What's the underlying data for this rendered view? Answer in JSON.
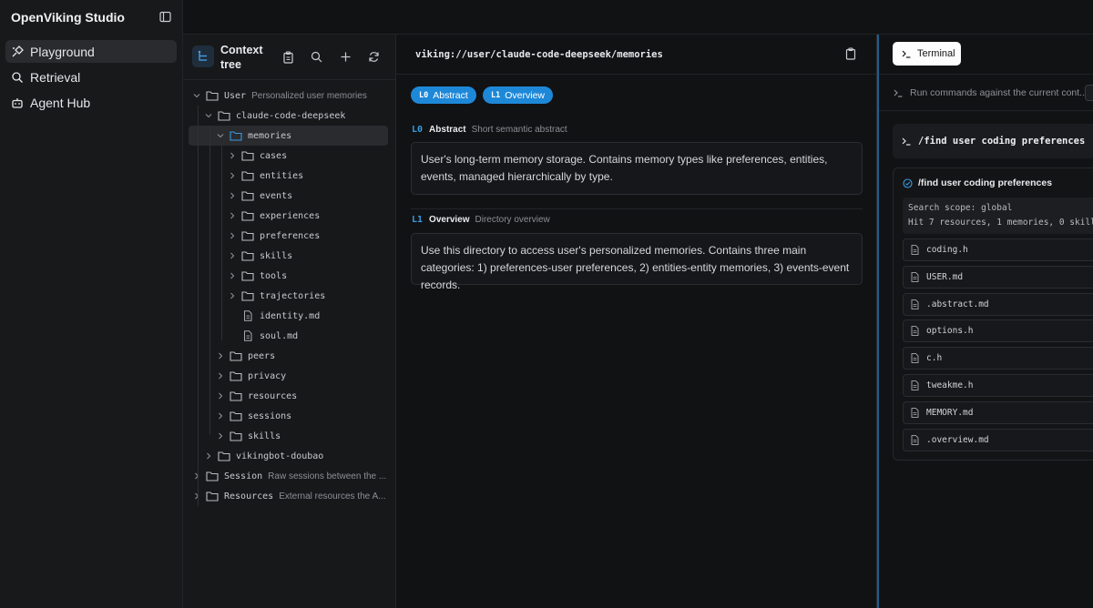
{
  "app": {
    "title": "OpenViking Studio"
  },
  "nav": {
    "items": [
      {
        "label": "Playground",
        "icon": "pen-nib-icon",
        "active": true
      },
      {
        "label": "Retrieval",
        "icon": "search-icon",
        "active": false
      },
      {
        "label": "Agent Hub",
        "icon": "robot-icon",
        "active": false
      }
    ]
  },
  "tree": {
    "title": "Context tree",
    "rows": [
      {
        "name": "User",
        "desc": "Personalized user memories",
        "type": "folder",
        "depth": 0,
        "expanded": true
      },
      {
        "name": "claude-code-deepseek",
        "desc": "",
        "type": "folder",
        "depth": 1,
        "expanded": true
      },
      {
        "name": "memories",
        "desc": "",
        "type": "folder",
        "depth": 2,
        "expanded": true,
        "selected": true
      },
      {
        "name": "cases",
        "desc": "",
        "type": "folder",
        "depth": 3,
        "expanded": false
      },
      {
        "name": "entities",
        "desc": "",
        "type": "folder",
        "depth": 3,
        "expanded": false
      },
      {
        "name": "events",
        "desc": "",
        "type": "folder",
        "depth": 3,
        "expanded": false
      },
      {
        "name": "experiences",
        "desc": "",
        "type": "folder",
        "depth": 3,
        "expanded": false
      },
      {
        "name": "preferences",
        "desc": "",
        "type": "folder",
        "depth": 3,
        "expanded": false
      },
      {
        "name": "skills",
        "desc": "",
        "type": "folder",
        "depth": 3,
        "expanded": false
      },
      {
        "name": "tools",
        "desc": "",
        "type": "folder",
        "depth": 3,
        "expanded": false
      },
      {
        "name": "trajectories",
        "desc": "",
        "type": "folder",
        "depth": 3,
        "expanded": false
      },
      {
        "name": "identity.md",
        "desc": "",
        "type": "file",
        "depth": 3
      },
      {
        "name": "soul.md",
        "desc": "",
        "type": "file",
        "depth": 3
      },
      {
        "name": "peers",
        "desc": "",
        "type": "folder",
        "depth": 2,
        "expanded": false
      },
      {
        "name": "privacy",
        "desc": "",
        "type": "folder",
        "depth": 2,
        "expanded": false
      },
      {
        "name": "resources",
        "desc": "",
        "type": "folder",
        "depth": 2,
        "expanded": false
      },
      {
        "name": "sessions",
        "desc": "",
        "type": "folder",
        "depth": 2,
        "expanded": false
      },
      {
        "name": "skills",
        "desc": "",
        "type": "folder",
        "depth": 2,
        "expanded": false
      },
      {
        "name": "vikingbot-doubao",
        "desc": "",
        "type": "folder",
        "depth": 1,
        "expanded": false
      },
      {
        "name": "Session",
        "desc": "Raw sessions between the ...",
        "type": "folder",
        "depth": 0,
        "expanded": false
      },
      {
        "name": "Resources",
        "desc": "External resources the A...",
        "type": "folder",
        "depth": 0,
        "expanded": false
      }
    ]
  },
  "detail": {
    "path": "viking://user/claude-code-deepseek/memories",
    "pills": [
      {
        "level": "L0",
        "label": "Abstract"
      },
      {
        "level": "L1",
        "label": "Overview"
      }
    ],
    "abstract": {
      "level": "L0",
      "title": "Abstract",
      "subtitle": "Short semantic abstract",
      "text": "User's long-term memory storage. Contains memory types like preferences, entities, events, managed hierarchically by type."
    },
    "overview": {
      "level": "L1",
      "title": "Overview",
      "subtitle": "Directory overview",
      "text": "Use this directory to access user's personalized memories. Contains three main categories: 1) preferences-user preferences, 2) entities-entity memories, 3) events-event records."
    }
  },
  "terminal": {
    "tab_label": "Terminal",
    "hint": "Run commands against the current cont...",
    "command": "/find user coding preferences",
    "result": {
      "title": "/find user coding preferences",
      "scope_line1": "Search scope: global",
      "scope_line2": "Hit 7 resources, 1 memories, 0 skills",
      "hits": [
        "coding.h",
        "USER.md",
        ".abstract.md",
        "options.h",
        "c.h",
        "tweakme.h",
        "MEMORY.md",
        ".overview.md"
      ]
    }
  }
}
